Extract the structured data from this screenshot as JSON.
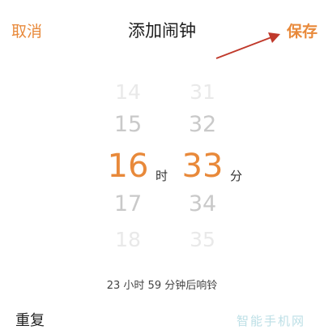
{
  "header": {
    "cancel_label": "取消",
    "title": "添加闹钟",
    "save_label": "保存"
  },
  "picker": {
    "hours": [
      "14",
      "15",
      "16",
      "17",
      "18"
    ],
    "minutes": [
      "31",
      "32",
      "33",
      "34",
      "35"
    ],
    "selected_hour": "16",
    "selected_minute": "33",
    "hour_unit": "时",
    "minute_unit": "分"
  },
  "ring_info": "23 小时 59 分钟后响铃",
  "repeat_label": "重复",
  "watermark": "智能手机网",
  "colors": {
    "accent": "#e8893a",
    "annotation_arrow": "#c0392b"
  }
}
